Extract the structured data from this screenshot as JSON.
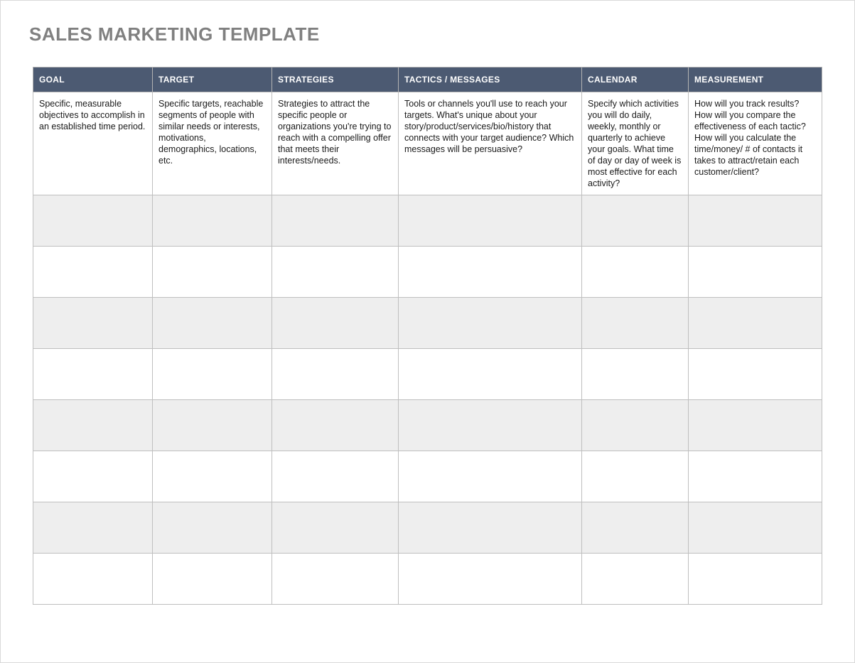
{
  "title": "SALES MARKETING TEMPLATE",
  "headers": {
    "goal": "GOAL",
    "target": "TARGET",
    "strategies": "STRATEGIES",
    "tactics": "TACTICS / MESSAGES",
    "calendar": "CALENDAR",
    "measurement": "MEASUREMENT"
  },
  "descriptions": {
    "goal": "Specific, measurable objectives to accomplish in an established time period.",
    "target": "Specific targets, reachable segments of people with similar needs or interests, motivations, demographics, locations, etc.",
    "strategies": "Strategies to attract the specific people or organizations you're trying to reach with a compelling offer that meets their interests/needs.",
    "tactics": "Tools or channels you'll use to reach your targets. What's unique about your story/product/services/bio/history that connects with your target audience? Which messages will be persuasive?",
    "calendar": "Specify which activities you will do daily, weekly, monthly or\nquarterly to achieve your goals. What time of day or day of week is most effective for each activity?",
    "measurement": "How will you track results? How will you compare the effectiveness of each\ntactic? How will you calculate the time/money/ # of contacts it takes to attract/retain each customer/client?"
  },
  "blank_row_count": 8
}
